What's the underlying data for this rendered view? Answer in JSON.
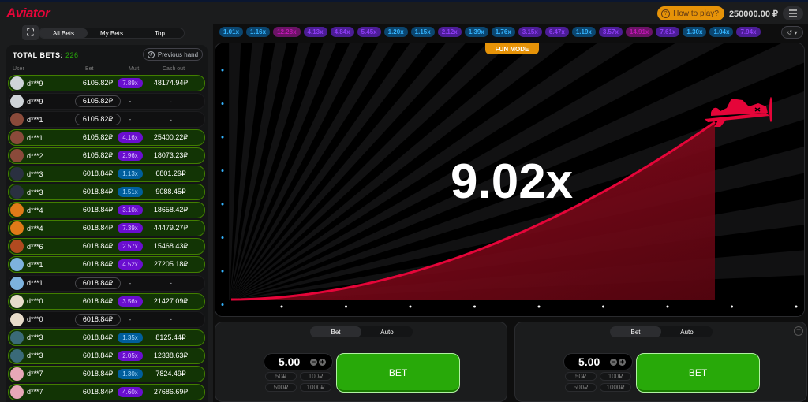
{
  "app": {
    "title": "Aviator"
  },
  "header": {
    "how_to_play": "How to play?",
    "balance": "250000.00 ₽"
  },
  "sidebar": {
    "tabs": [
      {
        "label": "All Bets",
        "active": true
      },
      {
        "label": "My Bets",
        "active": false
      },
      {
        "label": "Top",
        "active": false
      }
    ],
    "total_bets_label": "TOTAL BETS:",
    "total_bets_value": "226",
    "previous_hand": "Previous hand",
    "columns": {
      "user": "User",
      "bet": "Bet",
      "mult": "Mult.",
      "cashout": "Cash out"
    },
    "rows": [
      {
        "user": "d***9",
        "bet": "6105.82₽",
        "mult": "7.89x",
        "mult_color": "purple",
        "cashout": "48174.94₽",
        "won": true,
        "avatar": "#cfd4d8"
      },
      {
        "user": "d***9",
        "bet": "6105.82₽",
        "mult": "-",
        "mult_color": "dash",
        "cashout": "-",
        "won": false,
        "avatar": "#cfd4d8"
      },
      {
        "user": "d***1",
        "bet": "6105.82₽",
        "mult": "-",
        "mult_color": "dash",
        "cashout": "-",
        "won": false,
        "avatar": "#8a4a3a"
      },
      {
        "user": "d***1",
        "bet": "6105.82₽",
        "mult": "4.16x",
        "mult_color": "purple",
        "cashout": "25400.22₽",
        "won": true,
        "avatar": "#8a4a3a"
      },
      {
        "user": "d***2",
        "bet": "6105.82₽",
        "mult": "2.96x",
        "mult_color": "purple",
        "cashout": "18073.23₽",
        "won": true,
        "avatar": "#8a4a3a"
      },
      {
        "user": "d***3",
        "bet": "6018.84₽",
        "mult": "1.13x",
        "mult_color": "blue",
        "cashout": "6801.29₽",
        "won": true,
        "avatar": "#2a3040"
      },
      {
        "user": "d***3",
        "bet": "6018.84₽",
        "mult": "1.51x",
        "mult_color": "blue",
        "cashout": "9088.45₽",
        "won": true,
        "avatar": "#2a3040"
      },
      {
        "user": "d***4",
        "bet": "6018.84₽",
        "mult": "3.10x",
        "mult_color": "purple",
        "cashout": "18658.42₽",
        "won": true,
        "avatar": "#e07a18"
      },
      {
        "user": "d***4",
        "bet": "6018.84₽",
        "mult": "7.39x",
        "mult_color": "purple",
        "cashout": "44479.27₽",
        "won": true,
        "avatar": "#e07a18"
      },
      {
        "user": "d***6",
        "bet": "6018.84₽",
        "mult": "2.57x",
        "mult_color": "purple",
        "cashout": "15468.43₽",
        "won": true,
        "avatar": "#b04a20"
      },
      {
        "user": "d***1",
        "bet": "6018.84₽",
        "mult": "4.52x",
        "mult_color": "purple",
        "cashout": "27205.18₽",
        "won": true,
        "avatar": "#7db2dd"
      },
      {
        "user": "d***1",
        "bet": "6018.84₽",
        "mult": "-",
        "mult_color": "dash",
        "cashout": "-",
        "won": false,
        "avatar": "#7db2dd"
      },
      {
        "user": "d***0",
        "bet": "6018.84₽",
        "mult": "3.56x",
        "mult_color": "purple",
        "cashout": "21427.09₽",
        "won": true,
        "avatar": "#e8dccb"
      },
      {
        "user": "d***0",
        "bet": "6018.84₽",
        "mult": "-",
        "mult_color": "dash",
        "cashout": "-",
        "won": false,
        "avatar": "#e8dccb"
      },
      {
        "user": "d***3",
        "bet": "6018.84₽",
        "mult": "1.35x",
        "mult_color": "blue",
        "cashout": "8125.44₽",
        "won": true,
        "avatar": "#3a6a78"
      },
      {
        "user": "d***3",
        "bet": "6018.84₽",
        "mult": "2.05x",
        "mult_color": "purple",
        "cashout": "12338.63₽",
        "won": true,
        "avatar": "#3a6a78"
      },
      {
        "user": "d***7",
        "bet": "6018.84₽",
        "mult": "1.30x",
        "mult_color": "blue",
        "cashout": "7824.49₽",
        "won": true,
        "avatar": "#e8a8b8"
      },
      {
        "user": "d***7",
        "bet": "6018.84₽",
        "mult": "4.60x",
        "mult_color": "purple",
        "cashout": "27686.69₽",
        "won": true,
        "avatar": "#e8a8b8"
      }
    ]
  },
  "history": [
    {
      "v": "1.01x",
      "c": "blue"
    },
    {
      "v": "1.16x",
      "c": "blue"
    },
    {
      "v": "12.28x",
      "c": "pink"
    },
    {
      "v": "4.13x",
      "c": "purple"
    },
    {
      "v": "4.84x",
      "c": "purple"
    },
    {
      "v": "5.45x",
      "c": "purple"
    },
    {
      "v": "1.20x",
      "c": "blue"
    },
    {
      "v": "1.15x",
      "c": "blue"
    },
    {
      "v": "2.12x",
      "c": "purple"
    },
    {
      "v": "1.39x",
      "c": "blue"
    },
    {
      "v": "1.76x",
      "c": "blue"
    },
    {
      "v": "3.15x",
      "c": "purple"
    },
    {
      "v": "6.47x",
      "c": "purple"
    },
    {
      "v": "1.19x",
      "c": "blue"
    },
    {
      "v": "3.57x",
      "c": "purple"
    },
    {
      "v": "14.91x",
      "c": "pink"
    },
    {
      "v": "7.61x",
      "c": "purple"
    },
    {
      "v": "1.30x",
      "c": "blue"
    },
    {
      "v": "1.04x",
      "c": "blue"
    },
    {
      "v": "7.94x",
      "c": "purple"
    }
  ],
  "game": {
    "fun_mode": "FUN MODE",
    "multiplier": "9.02x",
    "curve_color": "#e50539"
  },
  "bet_panels": [
    {
      "tabs": [
        "Bet",
        "Auto"
      ],
      "amount": "5.00",
      "quick": [
        "50₽",
        "100₽",
        "500₽",
        "1000₽"
      ],
      "button": "BET",
      "removable": false
    },
    {
      "tabs": [
        "Bet",
        "Auto"
      ],
      "amount": "5.00",
      "quick": [
        "50₽",
        "100₽",
        "500₽",
        "1000₽"
      ],
      "button": "BET",
      "removable": true
    }
  ]
}
